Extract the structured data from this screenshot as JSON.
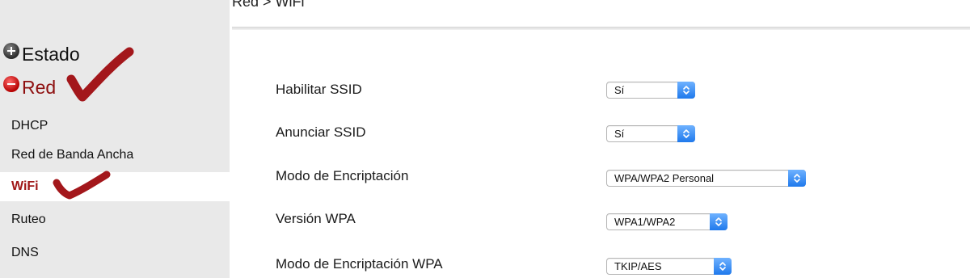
{
  "breadcrumb": "Red > WiFi",
  "sidebar": {
    "groups": [
      {
        "label": "Estado",
        "icon": "expand-plus-icon"
      },
      {
        "label": "Red",
        "icon": "collapse-minus-icon"
      }
    ],
    "items": [
      {
        "label": "DHCP"
      },
      {
        "label": "Red de Banda Ancha"
      },
      {
        "label": "WiFi",
        "active": true
      },
      {
        "label": "Ruteo"
      },
      {
        "label": "DNS"
      }
    ]
  },
  "form": {
    "fields": [
      {
        "label": "Habilitar SSID",
        "value": "Sí"
      },
      {
        "label": "Anunciar SSID",
        "value": "Sí"
      },
      {
        "label": "Modo de Encriptación",
        "value": "WPA/WPA2 Personal"
      },
      {
        "label": "Versión WPA",
        "value": "WPA1/WPA2"
      },
      {
        "label": "Modo de Encriptación WPA",
        "value": "TKIP/AES"
      }
    ]
  },
  "colors": {
    "sidebar_bg": "#e9e9e9",
    "active_text": "#a01818",
    "annotation_check": "#a3171b",
    "select_accent": "#1f79ec"
  }
}
